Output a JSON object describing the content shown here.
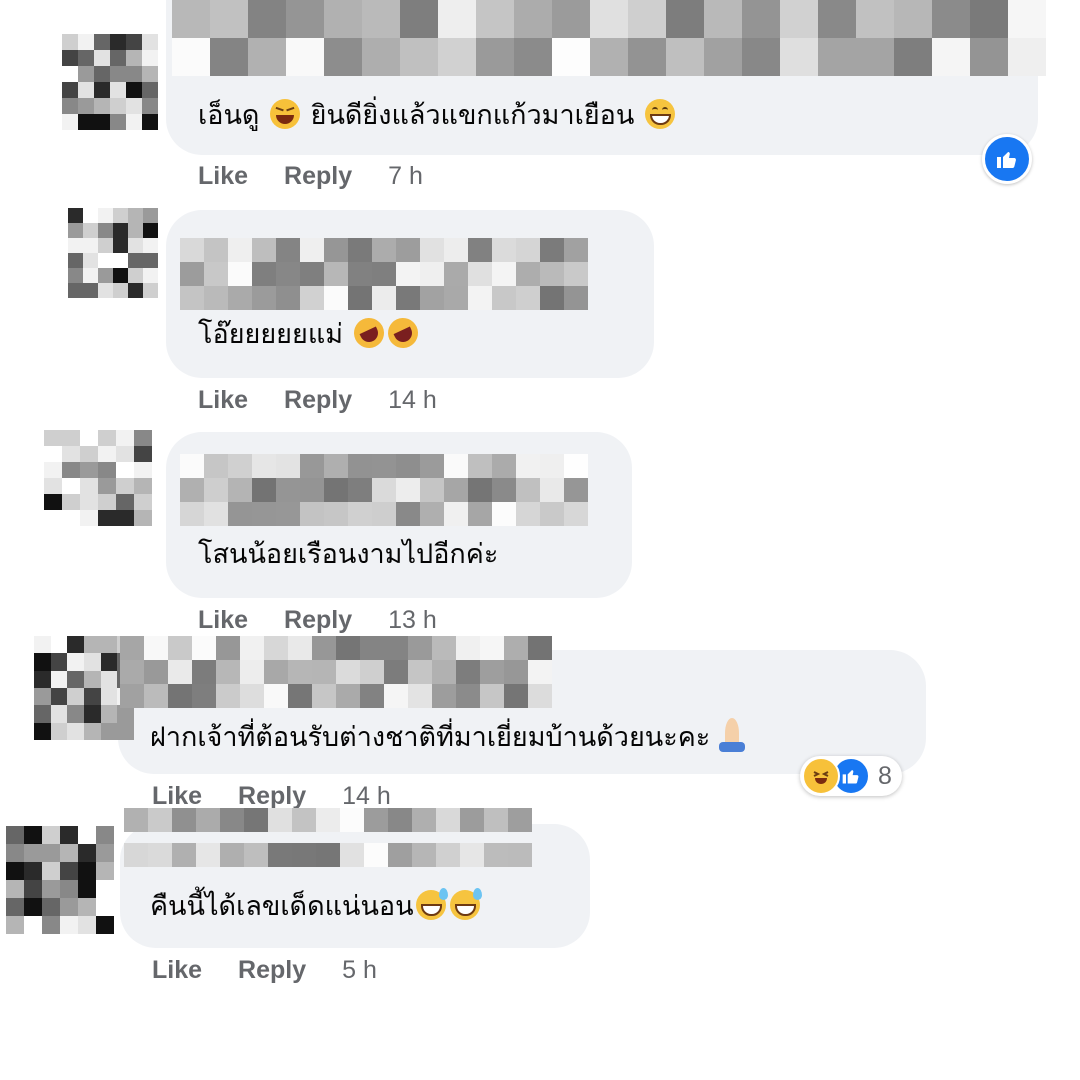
{
  "actions": {
    "like_label": "Like",
    "reply_label": "Reply"
  },
  "colors": {
    "bubble": "#f0f2f5",
    "accent": "#1877f2",
    "muted": "#65676b"
  },
  "comments": [
    {
      "text": "เอ็นดู",
      "text2": "ยินดียิ่งแล้วแขกแก้วมาเยือน",
      "time": "7 h",
      "reaction_icon": "thumbs-up-icon"
    },
    {
      "text": "โอ๊ยยยยยแม่",
      "time": "14 h"
    },
    {
      "text": "โสนน้อยเรือนงามไปอีกค่ะ",
      "time": "13 h"
    },
    {
      "text": "ฝากเจ้าที่ต้อนรับต่างชาติที่มาเยี่ยมบ้านด้วยนะคะ",
      "time": "14 h",
      "reaction_count": "8",
      "reaction_icons": [
        "haha-icon",
        "thumbs-up-icon"
      ]
    },
    {
      "text": "คืนนี้ได้เลขเด็ดแน่นอน",
      "time": "5 h"
    }
  ]
}
